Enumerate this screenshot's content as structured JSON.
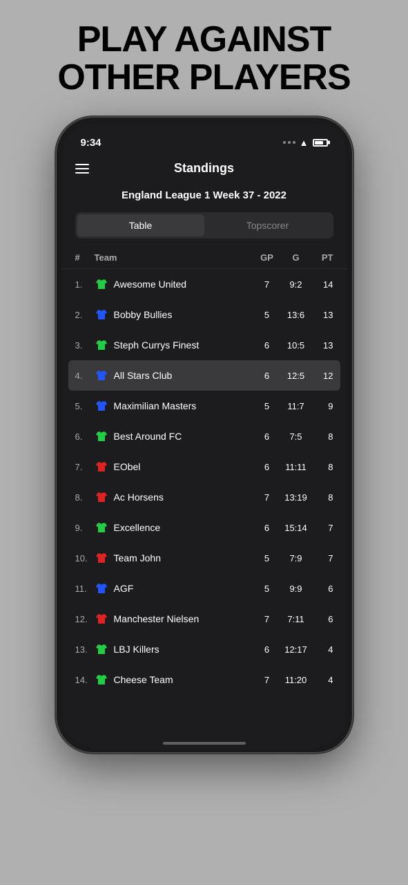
{
  "headline": {
    "line1": "PLAY AGAINST",
    "line2": "OTHER PLAYERS"
  },
  "status_bar": {
    "time": "9:34",
    "wifi": "wifi",
    "battery": "battery"
  },
  "nav": {
    "title": "Standings",
    "hamburger_label": "menu"
  },
  "league": {
    "title": "England League 1 Week 37 - 2022"
  },
  "tabs": [
    {
      "id": "table",
      "label": "Table",
      "active": true
    },
    {
      "id": "topscorer",
      "label": "Topscorer",
      "active": false
    }
  ],
  "table_headers": {
    "rank": "#",
    "team": "Team",
    "gp": "GP",
    "g": "G",
    "pt": "PT"
  },
  "rows": [
    {
      "rank": "1.",
      "jersey_color": "#22cc44",
      "team": "Awesome United",
      "gp": "7",
      "g": "9:2",
      "pt": "14",
      "highlighted": false
    },
    {
      "rank": "2.",
      "jersey_color": "#2255ff",
      "team": "Bobby Bullies",
      "gp": "5",
      "g": "13:6",
      "pt": "13",
      "highlighted": false
    },
    {
      "rank": "3.",
      "jersey_color": "#22cc44",
      "team": "Steph Currys Finest",
      "gp": "6",
      "g": "10:5",
      "pt": "13",
      "highlighted": false
    },
    {
      "rank": "4.",
      "jersey_color": "#2255ff",
      "team": "All Stars Club",
      "gp": "6",
      "g": "12:5",
      "pt": "12",
      "highlighted": true
    },
    {
      "rank": "5.",
      "jersey_color": "#2255ff",
      "team": "Maximilian Masters",
      "gp": "5",
      "g": "11:7",
      "pt": "9",
      "highlighted": false
    },
    {
      "rank": "6.",
      "jersey_color": "#22cc44",
      "team": "Best Around FC",
      "gp": "6",
      "g": "7:5",
      "pt": "8",
      "highlighted": false
    },
    {
      "rank": "7.",
      "jersey_color": "#dd2222",
      "team": "EObel",
      "gp": "6",
      "g": "11:11",
      "pt": "8",
      "highlighted": false
    },
    {
      "rank": "8.",
      "jersey_color": "#dd2222",
      "team": "Ac Horsens",
      "gp": "7",
      "g": "13:19",
      "pt": "8",
      "highlighted": false
    },
    {
      "rank": "9.",
      "jersey_color": "#22cc44",
      "team": "Excellence",
      "gp": "6",
      "g": "15:14",
      "pt": "7",
      "highlighted": false
    },
    {
      "rank": "10.",
      "jersey_color": "#dd2222",
      "team": "Team John",
      "gp": "5",
      "g": "7:9",
      "pt": "7",
      "highlighted": false
    },
    {
      "rank": "11.",
      "jersey_color": "#2255ff",
      "team": "AGF",
      "gp": "5",
      "g": "9:9",
      "pt": "6",
      "highlighted": false
    },
    {
      "rank": "12.",
      "jersey_color": "#dd2222",
      "team": "Manchester Nielsen",
      "gp": "7",
      "g": "7:11",
      "pt": "6",
      "highlighted": false
    },
    {
      "rank": "13.",
      "jersey_color": "#22cc44",
      "team": "LBJ Killers",
      "gp": "6",
      "g": "12:17",
      "pt": "4",
      "highlighted": false
    },
    {
      "rank": "14.",
      "jersey_color": "#22cc44",
      "team": "Cheese Team",
      "gp": "7",
      "g": "11:20",
      "pt": "4",
      "highlighted": false
    }
  ]
}
